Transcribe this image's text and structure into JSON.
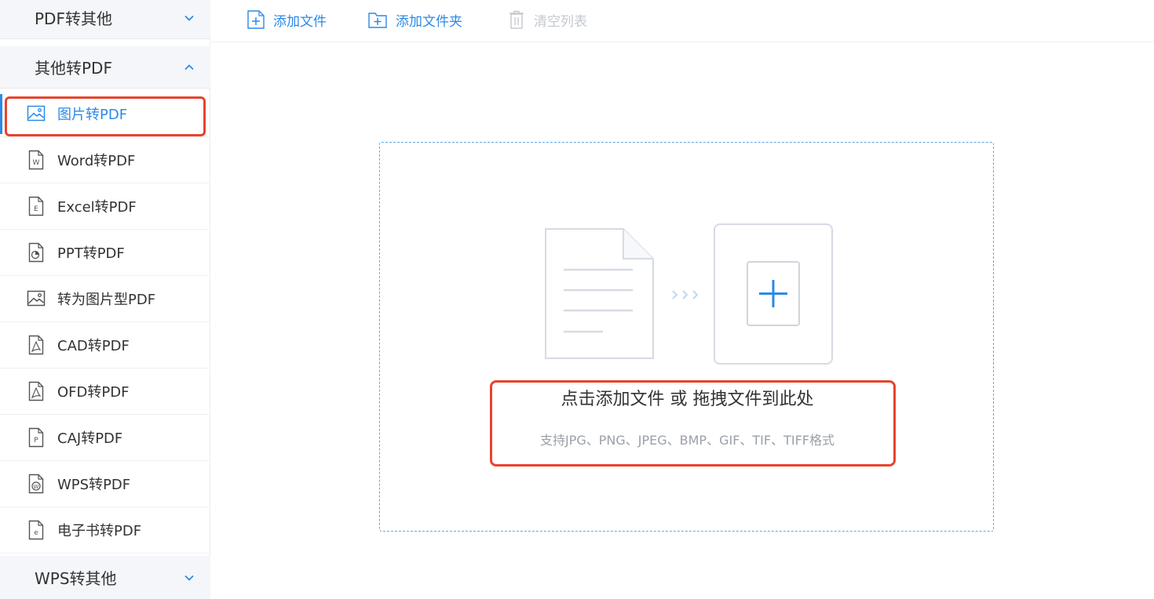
{
  "sidebar": {
    "groups": [
      {
        "label": "PDF转其他",
        "expanded": false
      },
      {
        "label": "其他转PDF",
        "expanded": true
      },
      {
        "label": "WPS转其他",
        "expanded": false
      }
    ],
    "items": [
      {
        "label": "图片转PDF",
        "icon": "image-icon",
        "active": true
      },
      {
        "label": "Word转PDF",
        "icon": "word-file-icon"
      },
      {
        "label": "Excel转PDF",
        "icon": "excel-file-icon"
      },
      {
        "label": "PPT转PDF",
        "icon": "ppt-file-icon"
      },
      {
        "label": "转为图片型PDF",
        "icon": "image-icon"
      },
      {
        "label": "CAD转PDF",
        "icon": "pdf-file-icon"
      },
      {
        "label": "OFD转PDF",
        "icon": "pdf-file-icon"
      },
      {
        "label": "CAJ转PDF",
        "icon": "caj-file-icon"
      },
      {
        "label": "WPS转PDF",
        "icon": "wps-file-icon"
      },
      {
        "label": "电子书转PDF",
        "icon": "ebook-file-icon"
      }
    ]
  },
  "toolbar": {
    "add_file": "添加文件",
    "add_folder": "添加文件夹",
    "clear_list": "清空列表"
  },
  "dropzone": {
    "main_text": "点击添加文件 或 拖拽文件到此处",
    "sub_text": "支持JPG、PNG、JPEG、BMP、GIF、TIF、TIFF格式"
  },
  "colors": {
    "accent": "#2b8ae6",
    "highlight_border": "#e8432d",
    "disabled": "#c4c8ce"
  }
}
